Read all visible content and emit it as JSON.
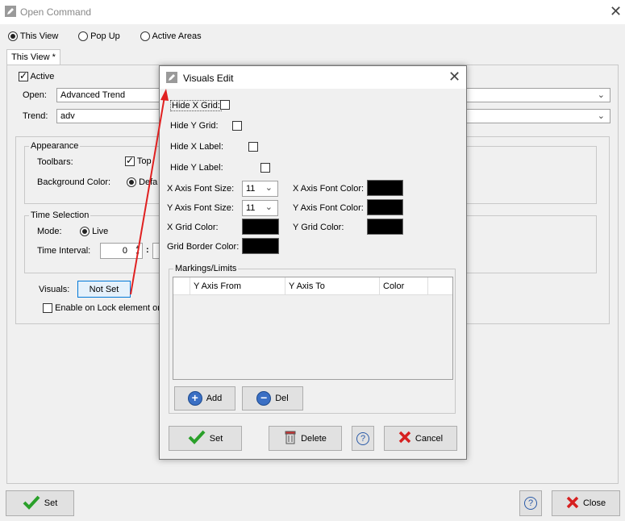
{
  "window": {
    "title": "Open Command"
  },
  "mode_options": [
    {
      "label": "This View",
      "selected": true
    },
    {
      "label": "Pop Up",
      "selected": false
    },
    {
      "label": "Active Areas",
      "selected": false
    }
  ],
  "tab": {
    "label": "This View *"
  },
  "active": {
    "label": "Active",
    "checked": true
  },
  "open_field": {
    "label": "Open:",
    "value": "Advanced Trend"
  },
  "trend_field": {
    "label": "Trend:",
    "value": "adv"
  },
  "appearance": {
    "legend": "Appearance",
    "toolbars_label": "Toolbars:",
    "toolbars_option": "Top",
    "bg_color_label": "Background Color:",
    "bg_color_option": "Defa"
  },
  "time_selection": {
    "legend": "Time Selection",
    "mode_label": "Mode:",
    "mode_option": "Live",
    "interval_label": "Time Interval:",
    "interval_value": "0",
    "separator": ":"
  },
  "visuals": {
    "label": "Visuals:",
    "button": "Not Set"
  },
  "lock": {
    "label": "Enable on Lock element or"
  },
  "bottom": {
    "set": "Set",
    "help": "?",
    "close": "Close"
  },
  "dialog": {
    "title": "Visuals Edit",
    "hide_x_grid": "Hide X Grid:",
    "hide_y_grid": "Hide Y Grid:",
    "hide_x_label": "Hide X Label:",
    "hide_y_label": "Hide Y Label:",
    "x_font_size_label": "X Axis Font Size:",
    "x_font_size_value": "11",
    "y_font_size_label": "Y Axis Font Size:",
    "y_font_size_value": "11",
    "x_font_color_label": "X Axis Font Color:",
    "y_font_color_label": "Y Axis Font Color:",
    "x_grid_color_label": "X Grid Color:",
    "y_grid_color_label": "Y Grid Color:",
    "grid_border_label": "Grid Border Color:",
    "markings_legend": "Markings/Limits",
    "columns": [
      "Y Axis From",
      "Y Axis To",
      "Color"
    ],
    "add": "Add",
    "del": "Del",
    "set": "Set",
    "delete": "Delete",
    "help": "?",
    "cancel": "Cancel"
  },
  "colors": {
    "swatch": "#000000",
    "arrow": "#e02020",
    "check_green": "#2aa02a",
    "cancel_red": "#d62020"
  }
}
